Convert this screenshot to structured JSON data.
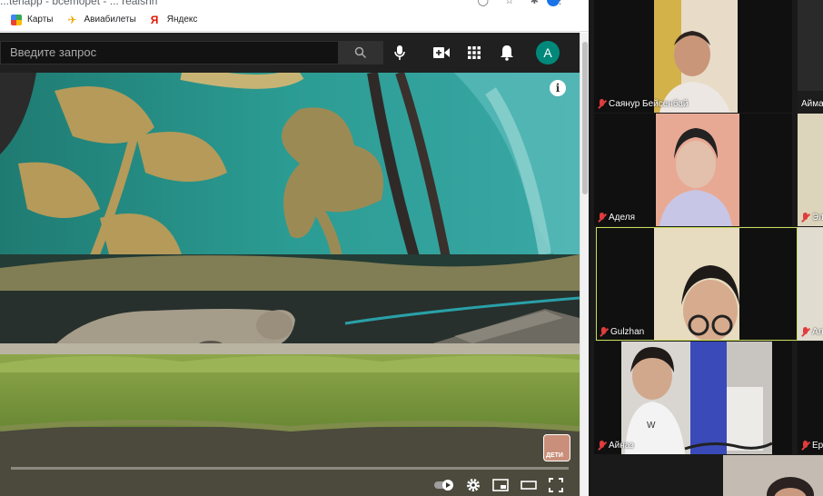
{
  "browser": {
    "url_text": "...tenapp - bcemopet - ... realshri",
    "bookmarks": [
      {
        "label": "Карты",
        "icon": "maps-icon"
      },
      {
        "label": "Авиабилеты",
        "icon": "plane-icon"
      },
      {
        "label": "Яндекс",
        "icon": "yandex-icon"
      }
    ]
  },
  "youtube": {
    "search_placeholder": "Введите запрос",
    "avatar_letter": "A",
    "accent_color": "#ff0000",
    "avatar_color": "#00897b",
    "icons": [
      "search-icon",
      "mic-icon",
      "create-video-icon",
      "apps-grid-icon",
      "notifications-bell-icon"
    ],
    "player": {
      "info_icon": "i",
      "channel_logo_text": "ДЕТИ",
      "progress": 0.0,
      "controls": [
        "autoplay-toggle-icon",
        "settings-gear-icon",
        "miniplayer-icon",
        "theater-mode-icon",
        "fullscreen-icon"
      ]
    }
  },
  "gallery": {
    "active_border_color": "#c6df5a",
    "participants": [
      {
        "name": "Саянур Бейсенбай",
        "muted": true,
        "video": true
      },
      {
        "name": "Аймa",
        "muted": false,
        "video": true
      },
      {
        "name": "Аделя",
        "muted": true,
        "video": true
      },
      {
        "name": "Эл",
        "muted": true,
        "video": true
      },
      {
        "name": "Gulzhan",
        "muted": true,
        "video": true,
        "active": true
      },
      {
        "name": "Ал",
        "muted": true,
        "video": true
      },
      {
        "name": "Айназ",
        "muted": true,
        "video": true
      },
      {
        "name": "Ер",
        "muted": true,
        "video": false
      },
      {
        "name": "",
        "muted": false,
        "video": true
      }
    ]
  }
}
